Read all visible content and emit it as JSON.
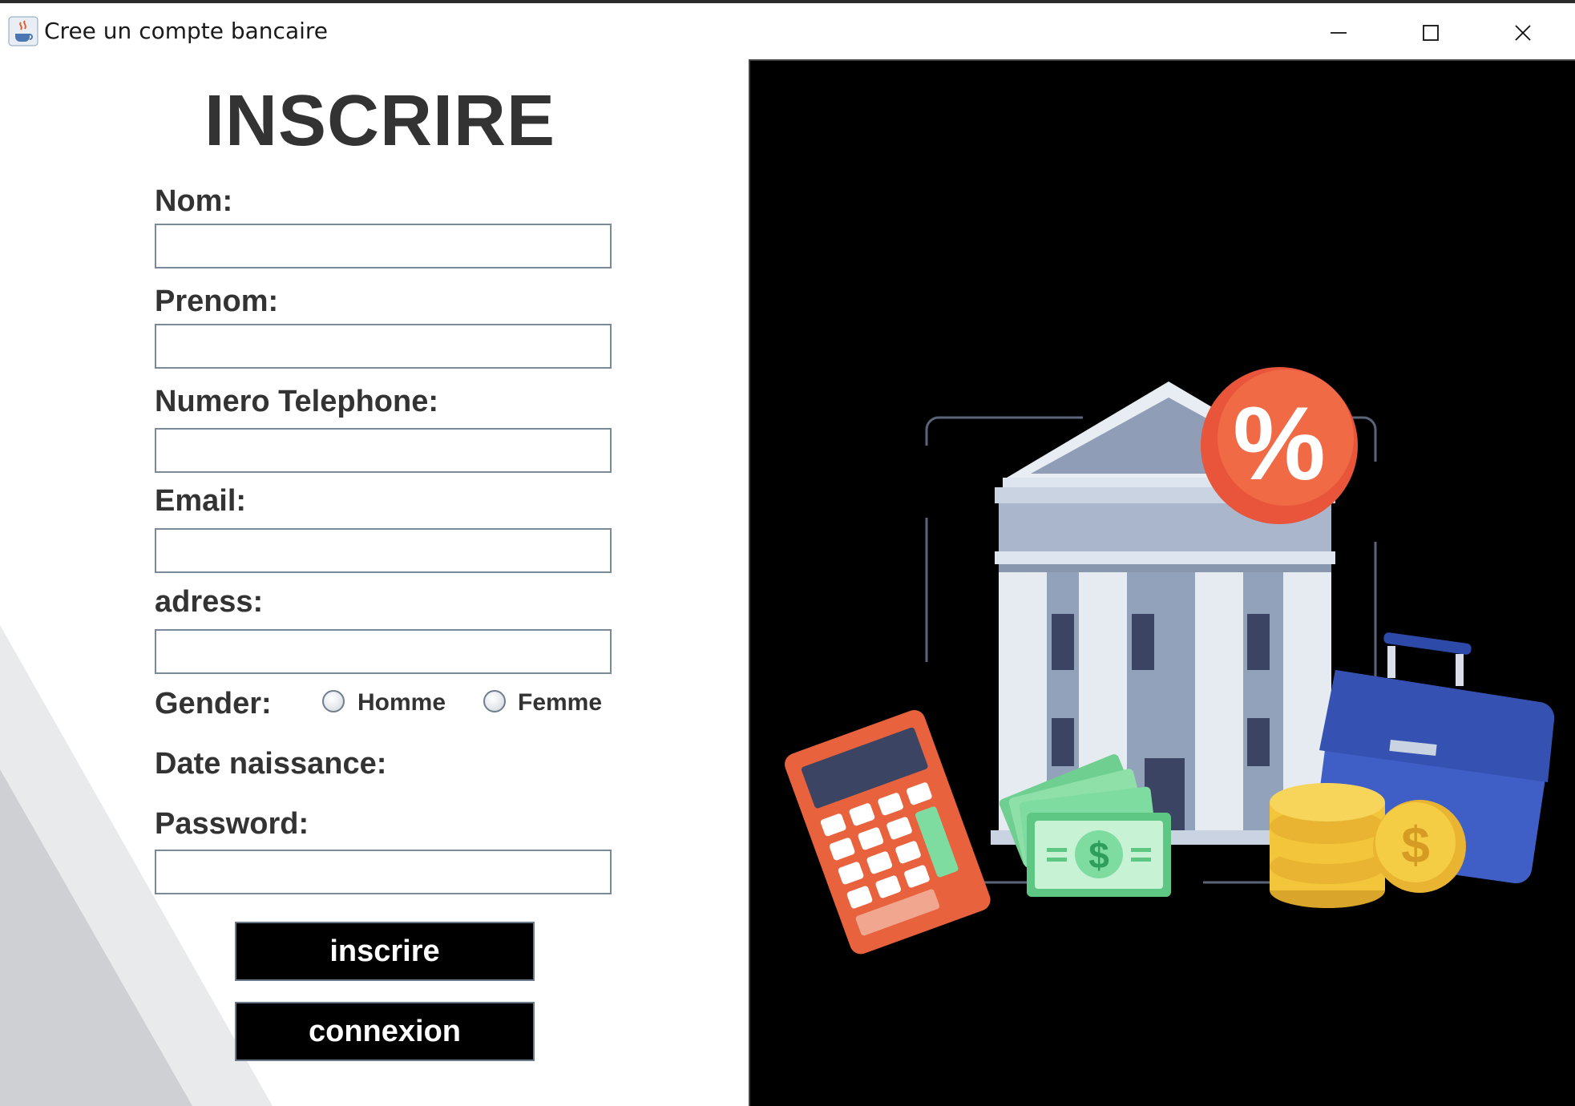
{
  "window": {
    "title": "Cree un compte bancaire",
    "icon": "java-cup-icon",
    "controls": [
      "minimize-icon",
      "maximize-icon",
      "close-icon"
    ]
  },
  "form": {
    "title": "INSCRIRE",
    "nom_label": "Nom:",
    "nom_value": "",
    "prenom_label": "Prenom:",
    "prenom_value": "",
    "telephone_label": "Numero Telephone:",
    "telephone_value": "",
    "email_label": "Email:",
    "email_value": "",
    "adress_label": "adress:",
    "adress_value": "",
    "gender_label": "Gender:",
    "gender_options": [
      "Homme",
      "Femme"
    ],
    "date_label": "Date naissance:",
    "password_label": "Password:",
    "password_value": "",
    "inscrire_button": "inscrire",
    "connexion_button": "connexion"
  },
  "illustration": {
    "icon": "bank-illustration",
    "percent_symbol": "%",
    "dollar_symbol": "$",
    "colors": {
      "background": "#000000",
      "percent_badge": "#e8553a",
      "bank": "#a9b6cc",
      "calculator": "#e8623e",
      "cash": "#7fdca0",
      "briefcase": "#3f5fc6",
      "coins": "#f2c53a"
    }
  }
}
